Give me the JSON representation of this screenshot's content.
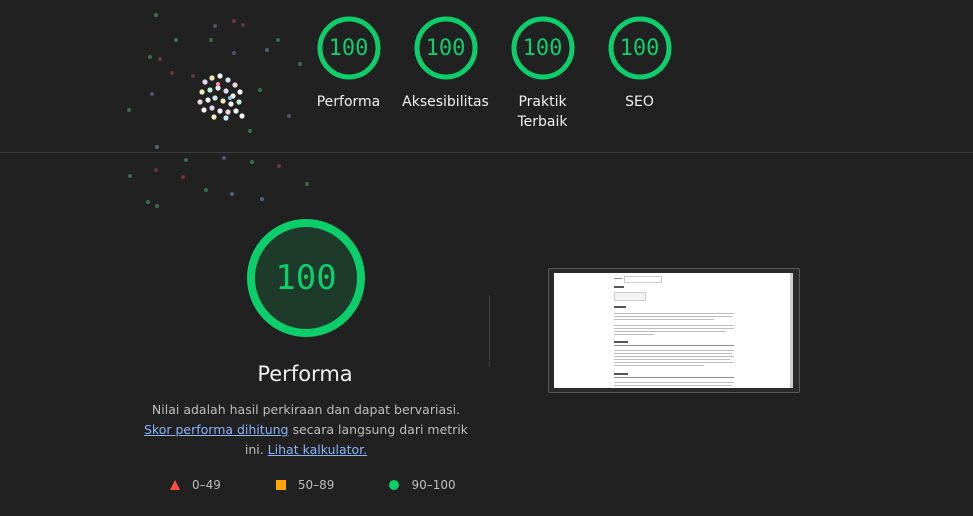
{
  "gauges": [
    {
      "score": "100",
      "label": "Performa"
    },
    {
      "score": "100",
      "label": "Aksesibilitas"
    },
    {
      "score": "100",
      "label": "Praktik Terbaik"
    },
    {
      "score": "100",
      "label": "SEO"
    }
  ],
  "performance": {
    "score": "100",
    "title": "Performa",
    "desc_part1": "Nilai adalah hasil perkiraan dan dapat bervariasi.",
    "link1": "Skor performa dihitung",
    "desc_part2": "secara langsung dari metrik ini.",
    "link2": "Lihat kalkulator."
  },
  "legend": [
    {
      "shape": "triangle",
      "range": "0–49",
      "color": "#ff4e42"
    },
    {
      "shape": "square",
      "range": "50–89",
      "color": "#ffa400"
    },
    {
      "shape": "circle",
      "range": "90–100",
      "color": "#0cce6b"
    }
  ],
  "colors": {
    "pass": "#0cce6b",
    "background": "#212121"
  }
}
